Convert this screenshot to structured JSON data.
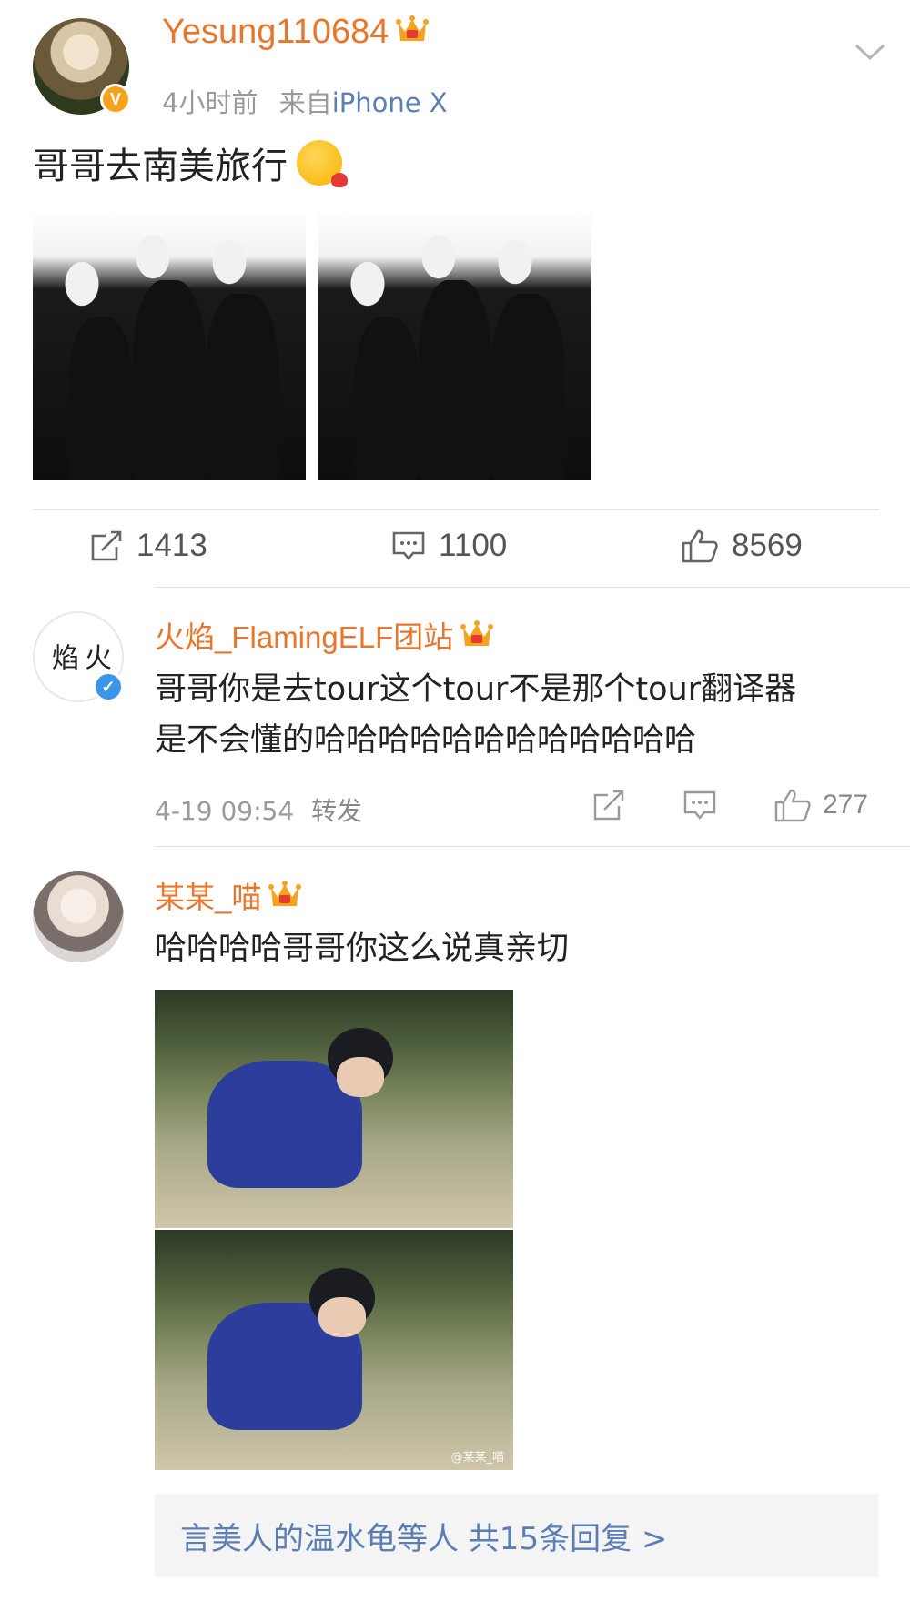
{
  "post": {
    "username": "Yesung110684",
    "time": "4小时前",
    "source_prefix": "来自",
    "source": "iPhone X",
    "text": "哥哥去南美旅行",
    "stats": {
      "repost": "1413",
      "comment": "1100",
      "like": "8569"
    }
  },
  "comments": [
    {
      "username": "火焰_FlamingELF团站",
      "avatar_text": "火焰",
      "line1": "哥哥你是去tour这个tour不是那个tour翻译器",
      "line2": "是不会懂的哈哈哈哈哈哈哈哈哈哈哈哈",
      "time": "4-19 09:54",
      "repost_label": "转发",
      "likes": "277"
    },
    {
      "username": "某某_喵",
      "text": "哈哈哈哈哥哥你这么说真亲切",
      "watermark": "@某某_喵"
    }
  ],
  "replies_link": "言美人的温水龟等人  共15条回复 >",
  "colors": {
    "username": "#e8772e",
    "link": "#5a7fb5",
    "meta": "#9a9a9a"
  }
}
